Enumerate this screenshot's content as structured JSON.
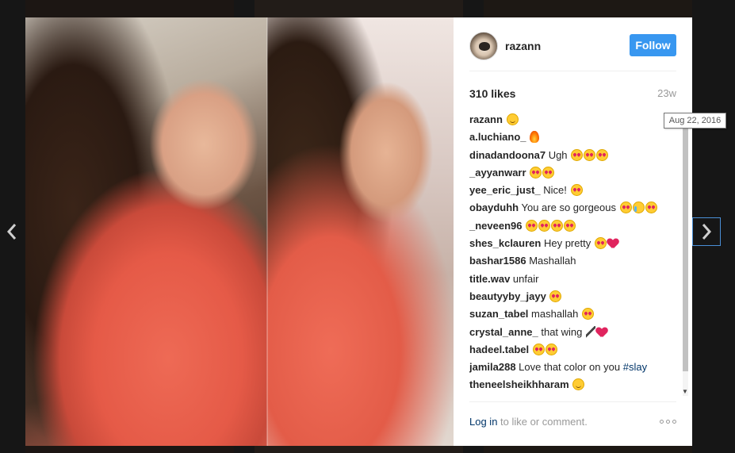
{
  "post": {
    "username": "razann",
    "follow_label": "Follow",
    "likes": "310 likes",
    "time_ago": "23w",
    "tooltip_date": "Aug 22, 2016"
  },
  "comments": [
    {
      "user": "razann",
      "text": "",
      "emojis": [
        "smile"
      ]
    },
    {
      "user": "a.luchiano_",
      "text": "",
      "emojis": [
        "fire"
      ]
    },
    {
      "user": "dinadandoona7",
      "text": "Ugh",
      "emojis": [
        "heart-eyes",
        "heart-eyes",
        "heart-eyes"
      ]
    },
    {
      "user": "_ayyanwarr",
      "text": "",
      "emojis": [
        "heart-eyes",
        "heart-eyes"
      ]
    },
    {
      "user": "yee_eric_just_",
      "text": "Nice!",
      "emojis": [
        "heart-eyes"
      ]
    },
    {
      "user": "obayduhh",
      "text": "You are so gorgeous",
      "emojis": [
        "heart-eyes",
        "crying",
        "heart-eyes"
      ]
    },
    {
      "user": "_neveen96",
      "text": "",
      "emojis": [
        "heart-eyes",
        "heart-eyes",
        "heart-eyes",
        "heart-eyes"
      ]
    },
    {
      "user": "shes_kclauren",
      "text": "Hey pretty",
      "emojis": [
        "heart-eyes",
        "red-heart"
      ]
    },
    {
      "user": "bashar1586",
      "text": "Mashallah",
      "emojis": []
    },
    {
      "user": "title.wav",
      "text": "unfair",
      "emojis": []
    },
    {
      "user": "beautyyby_jayy",
      "text": "",
      "emojis": [
        "heart-eyes"
      ]
    },
    {
      "user": "suzan_tabel",
      "text": "mashallah",
      "emojis": [
        "heart-eyes"
      ]
    },
    {
      "user": "crystal_anne_",
      "text": "that wing",
      "emojis": [
        "paintbrush",
        "red-heart"
      ]
    },
    {
      "user": "hadeel.tabel",
      "text": "",
      "emojis": [
        "heart-eyes",
        "heart-eyes"
      ]
    },
    {
      "user": "jamila288",
      "text": "Love that color on you",
      "hashtag": "#slay",
      "emojis": []
    },
    {
      "user": "theneelsheikhharam",
      "text": "",
      "emojis": [
        "smile"
      ]
    }
  ],
  "footer": {
    "login_label": "Log in",
    "rest_text": " to like or comment."
  },
  "icons": {
    "prev": "chevron-left-icon",
    "next": "chevron-right-icon",
    "more": "more-options-icon"
  },
  "colors": {
    "follow_bg": "#3897f0",
    "link": "#003569",
    "muted": "#999999"
  }
}
